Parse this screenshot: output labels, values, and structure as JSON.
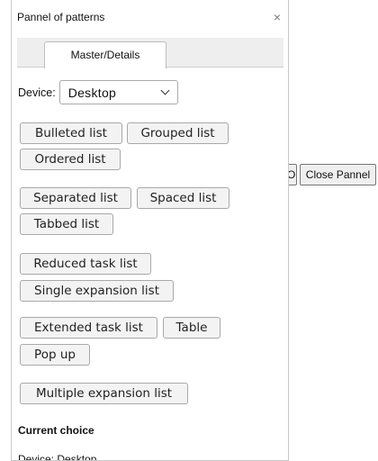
{
  "panel": {
    "title": "Pannel of patterns",
    "close_glyph": "×",
    "tab_label": "Master/Details",
    "device_label": "Device:",
    "device_value": "Desktop",
    "current_choice_title": "Current choice",
    "current_device": "Device: Desktop"
  },
  "pattern_groups": [
    [
      "Bulleted list",
      "Grouped list",
      "Ordered list"
    ],
    [
      "Separated list",
      "Spaced list",
      "Tabbed list"
    ],
    [
      "Reduced task list",
      "Single expansion list"
    ],
    [
      "Extended task list",
      "Table",
      "Pop up"
    ],
    [
      "Multiple expansion list"
    ]
  ],
  "background": {
    "clipped_button_label": "Open Pannel",
    "close_panel_label": "Close Pannel"
  }
}
